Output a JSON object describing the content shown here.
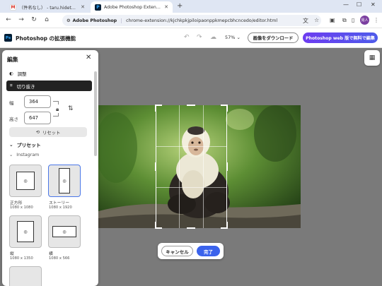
{
  "browser": {
    "tabs": [
      {
        "title": "（件名なし） - taru.hideto@gm",
        "active": false,
        "icon": "gmail-icon"
      },
      {
        "title": "Adobe Photoshop Extension",
        "active": true,
        "icon": "photoshop-icon"
      }
    ],
    "new_tab": "+",
    "site_chip": "Adobe Photoshop",
    "url": "chrome-extension://kjchkpkjpiloipaonppkmepcbhcncedo/editor.html",
    "profile_initials": "晃人"
  },
  "app": {
    "logo": "Ps",
    "title": "Photoshop の拡張機能",
    "zoom": "57%",
    "download_label": "画像をダウンロード",
    "ps_web_label": "Photoshop web 版で無料で編集"
  },
  "panel": {
    "title": "編集",
    "adjust_label": "調整",
    "crop_label": "切り抜き",
    "width_label": "幅",
    "width_value": "364",
    "height_label": "高さ",
    "height_value": "647",
    "reset_label": "リセット",
    "preset_label": "プリセット",
    "instagram_label": "Instagram",
    "presets": [
      {
        "name": "正方形",
        "size": "1080 x 1080"
      },
      {
        "name": "ストーリー",
        "size": "1080 x 1920",
        "selected": true
      },
      {
        "name": "縦",
        "size": "1080 x 1350"
      },
      {
        "name": "横",
        "size": "1080 x 566"
      }
    ]
  },
  "crop_actions": {
    "cancel_label": "キャンセル",
    "done_label": "完了"
  },
  "colors": {
    "accent": "#3b63ec",
    "ps_gradient_start": "#6d3cf0",
    "canvas_bg": "#7a7a7a"
  }
}
